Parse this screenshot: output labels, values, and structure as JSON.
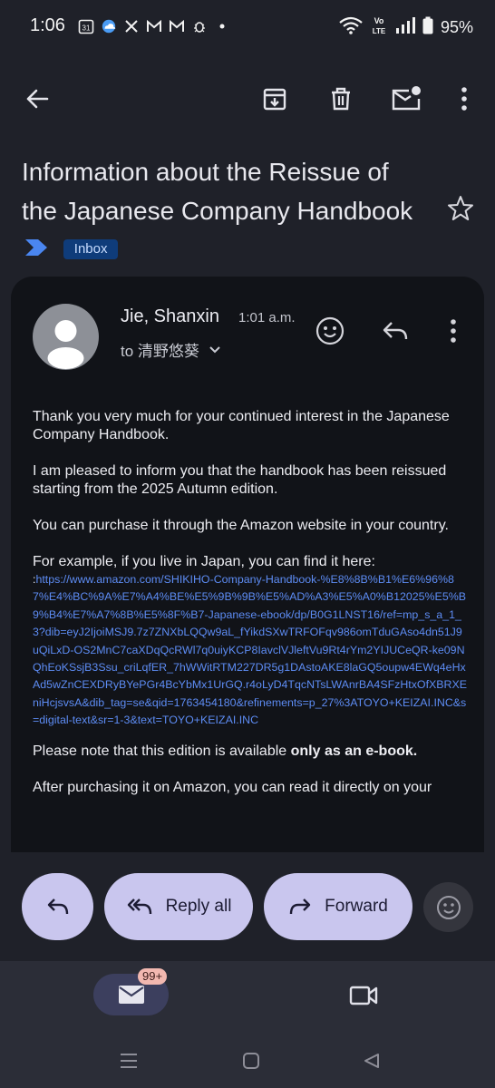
{
  "status_bar": {
    "time": "1:06",
    "calendar_day": "31",
    "battery": "95%",
    "volte": "Vo LTE"
  },
  "app_bar": {
    "back_icon": "arrow-back-icon",
    "archive_icon": "archive-icon",
    "delete_icon": "trash-icon",
    "mark_unread_icon": "mark-unread-icon",
    "more_icon": "more-vert-icon"
  },
  "email": {
    "subject": "Information about the Reissue of the Japanese Company Handbook",
    "label": "Inbox",
    "sender": "Jie, Shanxin",
    "time": "1:01 a.m.",
    "recipient": "to 清野悠葵",
    "body": {
      "p1": "Thank you very much for your continued interest in the Japanese Company Handbook.",
      "p2": "I am pleased to inform you that the handbook has been reissued starting from the 2025 Autumn edition.",
      "p3": "You can purchase it through the Amazon website in your country.",
      "p4": "For example, if you live in Japan, you can find it here:",
      "link_prefix": ":",
      "link": "https://www.amazon.com/SHIKIHO-Company-Handbook-%E8%8B%B1%E6%96%87%E4%BC%9A%E7%A4%BE%E5%9B%9B%E5%AD%A3%E5%A0%B12025%E5%B9%B4%E7%A7%8B%E5%8F%B7-Japanese-ebook/dp/B0G1LNST16/ref=mp_s_a_1_3?dib=eyJ2IjoiMSJ9.7z7ZNXbLQQw9aL_fYikdSXwTRFOFqv986omTduGAso4dn51J9uQiLxD-OS2MnC7caXDqQcRWl7q0uiyKCP8IavclVJleftVu9Rt4rYm2YIJUCeQR-ke09NQhEoKSsjB3Ssu_criLqfER_7hWWitRTM227DR5g1DAstoAKE8laGQ5oupw4EWq4eHxAd5wZnCEXDRyBYePGr4BcYbMx1UrGQ.r4oLyD4TqcNTsLWAnrBA4SFzHtxOfXBRXEniHcjsvsA&dib_tag=se&qid=1763454180&refinements=p_27%3ATOYO+KEIZAI.INC&s=digital-text&sr=1-3&text=TOYO+KEIZAI.INC",
      "p5_pre": "Please note that this edition is available ",
      "p5_bold": "only as an e-book.",
      "p6": "After purchasing it on Amazon, you can read it directly on your"
    }
  },
  "actions": {
    "reply_all": "Reply all",
    "forward": "Forward"
  },
  "bottom_nav": {
    "mail_badge": "99+"
  },
  "colors": {
    "background": "#1f2129",
    "card": "#111318",
    "pill": "#c9c6ee",
    "link": "#5d8cf4",
    "inbox_chip": "#0f3c7a"
  }
}
